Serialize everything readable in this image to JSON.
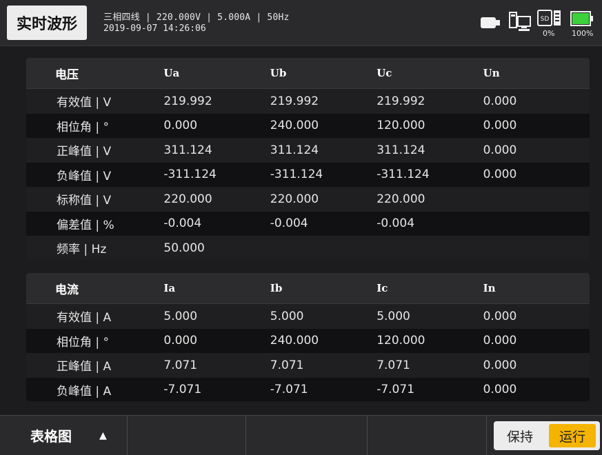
{
  "header": {
    "title": "实时波形",
    "info_line1": "三相四线 | 220.000V | 5.000A | 50Hz",
    "info_line2": "2019-09-07 14:26:06",
    "icons": [
      "usb-icon",
      "network-icon",
      "sd-card-icon",
      "battery-icon"
    ],
    "sd_usage": "0%",
    "battery": "100%",
    "battery_level": 1.0
  },
  "voltage": {
    "title": "电压",
    "columns": [
      "Ua",
      "Ub",
      "Uc",
      "Un"
    ],
    "rows": [
      {
        "label": "有效值 | V",
        "values": [
          "219.992",
          "219.992",
          "219.992",
          "0.000"
        ]
      },
      {
        "label": "相位角 | °",
        "values": [
          "0.000",
          "240.000",
          "120.000",
          "0.000"
        ]
      },
      {
        "label": "正峰值 | V",
        "values": [
          "311.124",
          "311.124",
          "311.124",
          "0.000"
        ]
      },
      {
        "label": "负峰值 | V",
        "values": [
          "-311.124",
          "-311.124",
          "-311.124",
          "0.000"
        ]
      },
      {
        "label": "标称值 | V",
        "values": [
          "220.000",
          "220.000",
          "220.000",
          ""
        ]
      },
      {
        "label": "偏差值 | %",
        "values": [
          "-0.004",
          "-0.004",
          "-0.004",
          ""
        ]
      },
      {
        "label": "频率 | Hz",
        "values": [
          "50.000",
          "",
          "",
          ""
        ]
      }
    ]
  },
  "current": {
    "title": "电流",
    "columns": [
      "Ia",
      "Ib",
      "Ic",
      "In"
    ],
    "rows": [
      {
        "label": "有效值 | A",
        "values": [
          "5.000",
          "5.000",
          "5.000",
          "0.000"
        ]
      },
      {
        "label": "相位角 | °",
        "values": [
          "0.000",
          "240.000",
          "120.000",
          "0.000"
        ]
      },
      {
        "label": "正峰值 | A",
        "values": [
          "7.071",
          "7.071",
          "7.071",
          "0.000"
        ]
      },
      {
        "label": "负峰值 | A",
        "values": [
          "-7.071",
          "-7.071",
          "-7.071",
          "0.000"
        ]
      }
    ]
  },
  "footer": {
    "view_label": "表格图",
    "view_icon": "triangle-up-icon",
    "hold_label": "保持",
    "run_label": "运行",
    "run_color": "#f5b400"
  }
}
